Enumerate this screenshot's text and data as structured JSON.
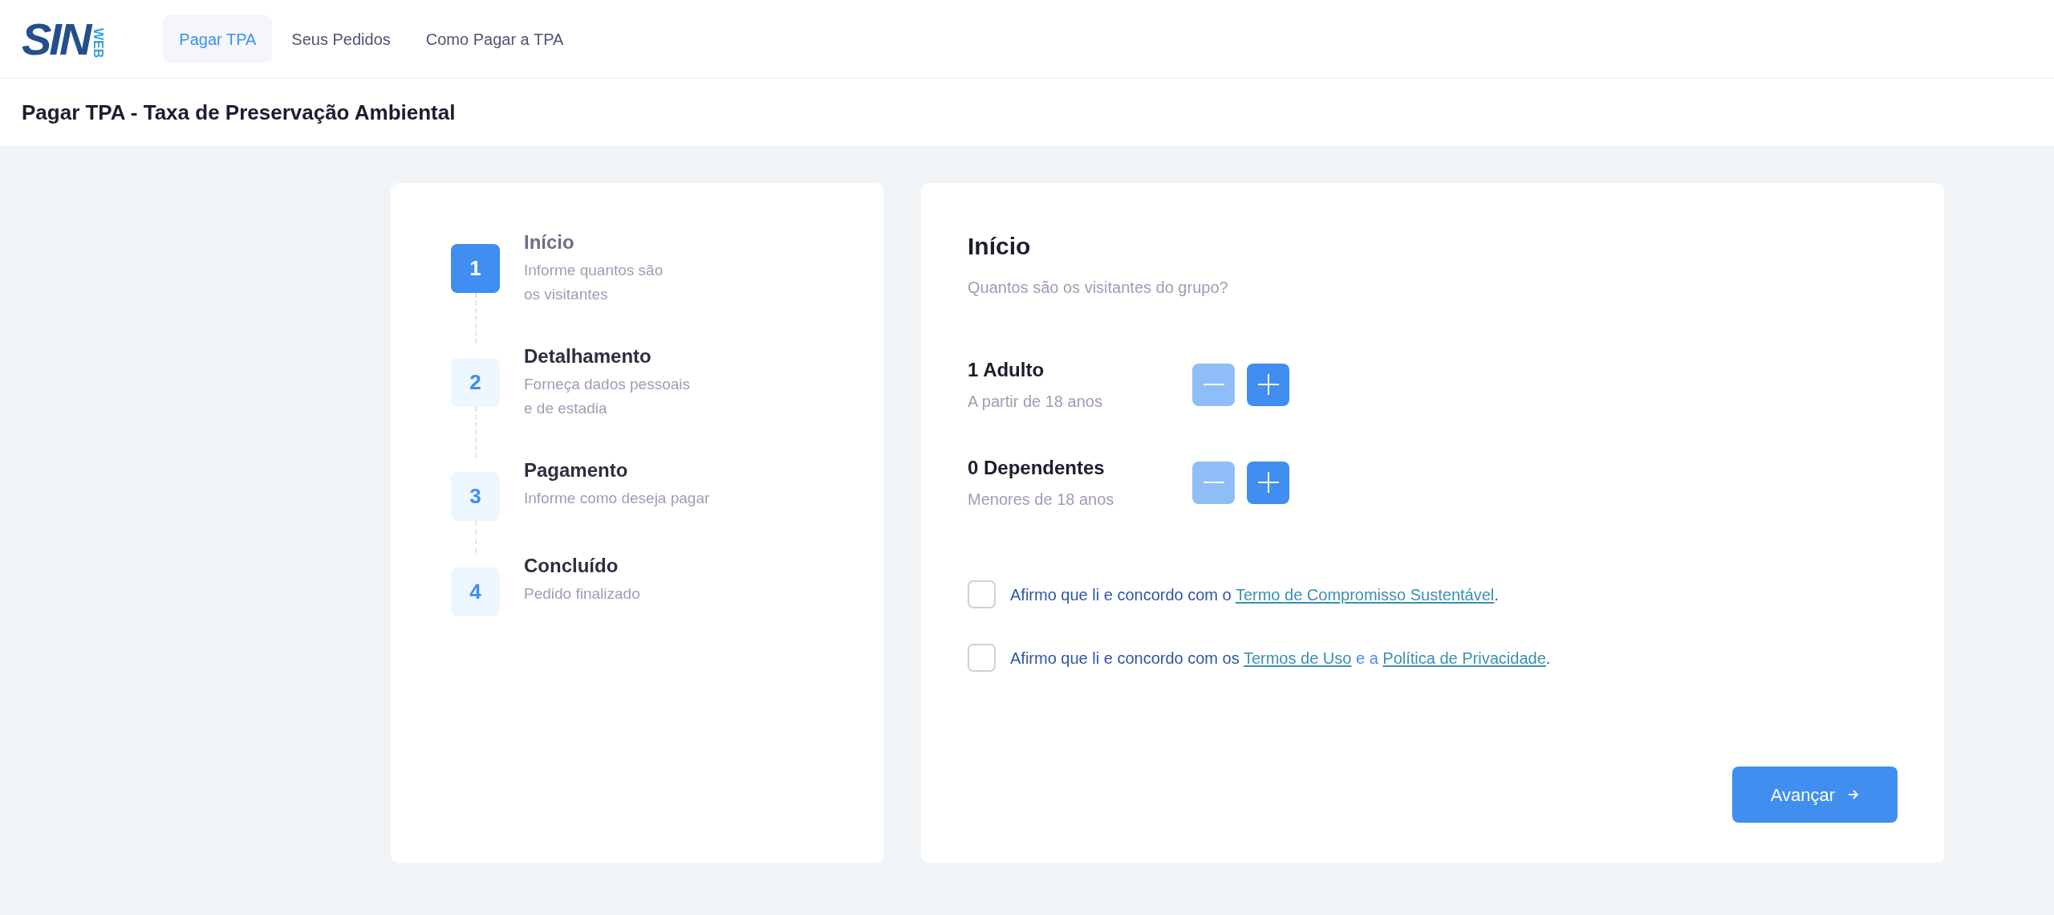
{
  "logo": {
    "main": "SIN",
    "side": "WEB"
  },
  "nav": [
    {
      "label": "Pagar TPA",
      "selected": true
    },
    {
      "label": "Seus Pedidos",
      "selected": false
    },
    {
      "label": "Como Pagar a TPA",
      "selected": false
    }
  ],
  "page_title": "Pagar TPA - Taxa de Preservação Ambiental",
  "steps": [
    {
      "number": "1",
      "title": "Início",
      "subtitle": "Informe quantos são\nos visitantes",
      "selected": true
    },
    {
      "number": "2",
      "title": "Detalhamento",
      "subtitle": "Forneça dados pessoais\ne de estadia",
      "selected": false
    },
    {
      "number": "3",
      "title": "Pagamento",
      "subtitle": "Informe como deseja pagar",
      "selected": false
    },
    {
      "number": "4",
      "title": "Concluído",
      "subtitle": "Pedido finalizado",
      "selected": false
    }
  ],
  "form": {
    "title": "Início",
    "subtitle": "Quantos são os visitantes do grupo?",
    "counters": [
      {
        "label": "1 Adulto",
        "hint": "A partir de 18 anos",
        "minus_disabled": true
      },
      {
        "label": "0 Dependentes",
        "hint": "Menores de 18 anos",
        "minus_disabled": true
      }
    ],
    "agreements": [
      {
        "checked": false,
        "parts": [
          {
            "kind": "text",
            "text": "Afirmo que li e concordo com o "
          },
          {
            "kind": "link",
            "text": "Termo de Compromisso Sustentável"
          },
          {
            "kind": "text",
            "text": "."
          }
        ]
      },
      {
        "checked": false,
        "parts": [
          {
            "kind": "text",
            "text": "Afirmo que li e concordo com os "
          },
          {
            "kind": "link",
            "text": "Termos de Uso"
          },
          {
            "kind": "joiner",
            "text": " e a "
          },
          {
            "kind": "link",
            "text": "Política de Privacidade"
          },
          {
            "kind": "text",
            "text": "."
          }
        ]
      }
    ],
    "submit": "Avançar"
  }
}
